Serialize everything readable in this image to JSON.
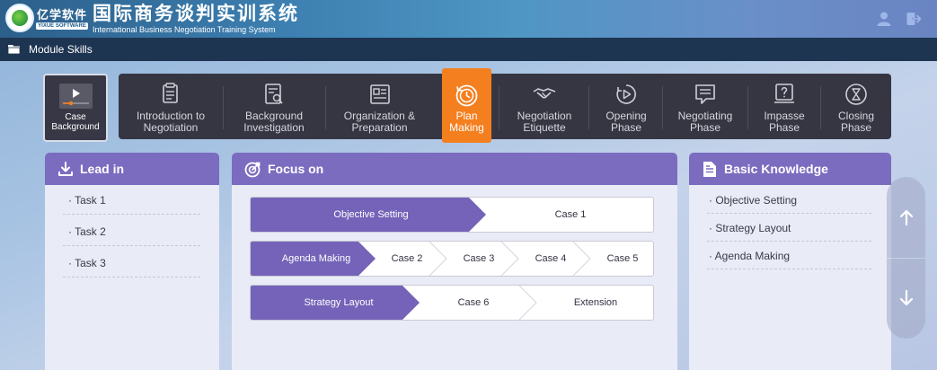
{
  "header": {
    "brand_cn": "亿学软件",
    "brand_en": "YIXUE SOFTWARE",
    "title": "国际商务谈判实训系统",
    "subtitle": "International Business Negotiation Training System"
  },
  "subbar": {
    "label": "Module Skills"
  },
  "case_background": {
    "label_line1": "Case",
    "label_line2": "Background"
  },
  "nav": {
    "items": [
      {
        "line1": "Introduction to",
        "line2": "Negotiation",
        "icon": "document-list-icon"
      },
      {
        "line1": "Background",
        "line2": "Investigation",
        "icon": "document-search-icon"
      },
      {
        "line1": "Organization &",
        "line2": "Preparation",
        "icon": "newspaper-icon"
      },
      {
        "line1": "Plan",
        "line2": "Making",
        "icon": "clock-history-icon",
        "active": true
      },
      {
        "line1": "Negotiation",
        "line2": "Etiquette",
        "icon": "handshake-icon"
      },
      {
        "line1": "Opening",
        "line2": "Phase",
        "icon": "play-cycle-icon"
      },
      {
        "line1": "Negotiating",
        "line2": "Phase",
        "icon": "chat-box-icon"
      },
      {
        "line1": "Impasse",
        "line2": "Phase",
        "icon": "question-box-icon"
      },
      {
        "line1": "Closing",
        "line2": "Phase",
        "icon": "hourglass-icon"
      }
    ],
    "active_color": "#f47f1f"
  },
  "lead_in": {
    "title": "Lead in",
    "tasks": [
      "· Task 1",
      "· Task 2",
      "· Task 3"
    ]
  },
  "focus_on": {
    "title": "Focus on",
    "rows": [
      {
        "main": "Objective Setting",
        "cases": [
          "Case 1"
        ]
      },
      {
        "main": "Agenda Making",
        "cases": [
          "Case 2",
          "Case 3",
          "Case 4",
          "Case 5"
        ]
      },
      {
        "main": "Strategy Layout",
        "cases": [
          "Case 6",
          "Extension"
        ]
      }
    ]
  },
  "basic_knowledge": {
    "title": "Basic Knowledge",
    "items": [
      "· Objective Setting",
      "· Strategy Layout",
      "· Agenda Making"
    ]
  },
  "colors": {
    "panel_header": "#7b6cc0",
    "focus_main": "#7463b8",
    "nav_bg": "#363642",
    "subbar_bg": "#1e3552"
  }
}
